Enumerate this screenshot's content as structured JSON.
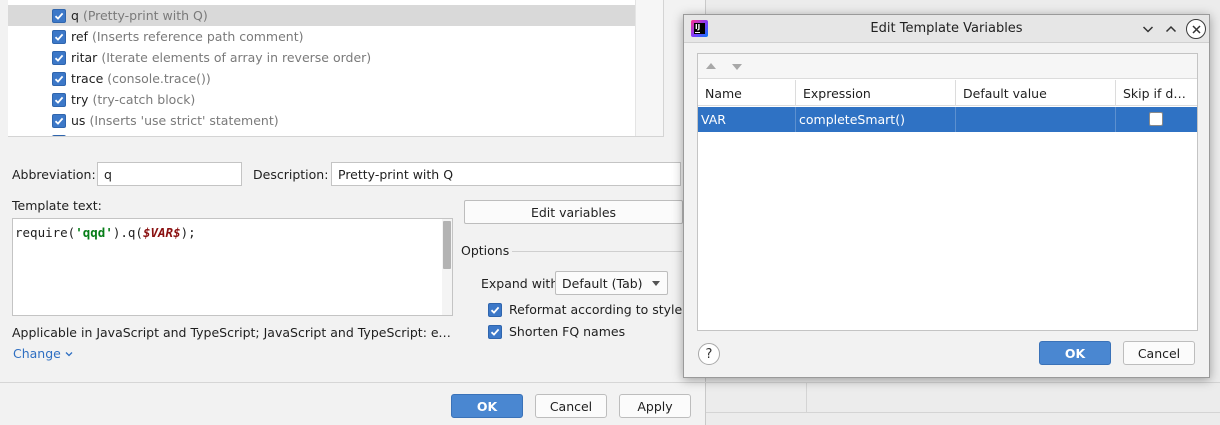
{
  "templates": {
    "items": [
      {
        "abbr": "q",
        "desc": "(Pretty-print with Q)",
        "checked": true,
        "selected": true
      },
      {
        "abbr": "ref",
        "desc": "(Inserts reference path comment)",
        "checked": true,
        "selected": false
      },
      {
        "abbr": "ritar",
        "desc": "(Iterate elements of array in reverse order)",
        "checked": true,
        "selected": false
      },
      {
        "abbr": "trace",
        "desc": "(console.trace())",
        "checked": true,
        "selected": false
      },
      {
        "abbr": "try",
        "desc": "(try-catch block)",
        "checked": true,
        "selected": false
      },
      {
        "abbr": "us",
        "desc": "(Inserts 'use strict' statement)",
        "checked": true,
        "selected": false
      }
    ]
  },
  "form": {
    "abbreviation_label": "Abbreviation:",
    "abbreviation_value": "q",
    "description_label": "Description:",
    "description_value": "Pretty-print with Q",
    "template_text_label": "Template text:",
    "code": {
      "part1": "require(",
      "string": "'qqd'",
      "part2": ").q(",
      "variable": "$VAR$",
      "part3": ");"
    },
    "edit_variables_label": "Edit variables",
    "options_label": "Options",
    "expand_with_label": "Expand with",
    "expand_with_value": "Default (Tab)",
    "reformat_label": "Reformat according to style",
    "shorten_label": "Shorten FQ names",
    "applicable_text": "Applicable in JavaScript and TypeScript; JavaScript and TypeScript: expression,...",
    "change_label": "Change"
  },
  "main_buttons": {
    "ok": "OK",
    "cancel": "Cancel",
    "apply": "Apply"
  },
  "var_dialog": {
    "title": "Edit Template Variables",
    "columns": [
      "Name",
      "Expression",
      "Default value",
      "Skip if defin..."
    ],
    "rows": [
      {
        "name": "VAR",
        "expression": "completeSmart()",
        "default_value": "",
        "skip_if_defined": false
      }
    ],
    "help_label": "?",
    "ok": "OK",
    "cancel": "Cancel"
  },
  "colors": {
    "accent": "#4a87d1",
    "selection": "#2f72c4",
    "link": "#2f6fc2"
  }
}
